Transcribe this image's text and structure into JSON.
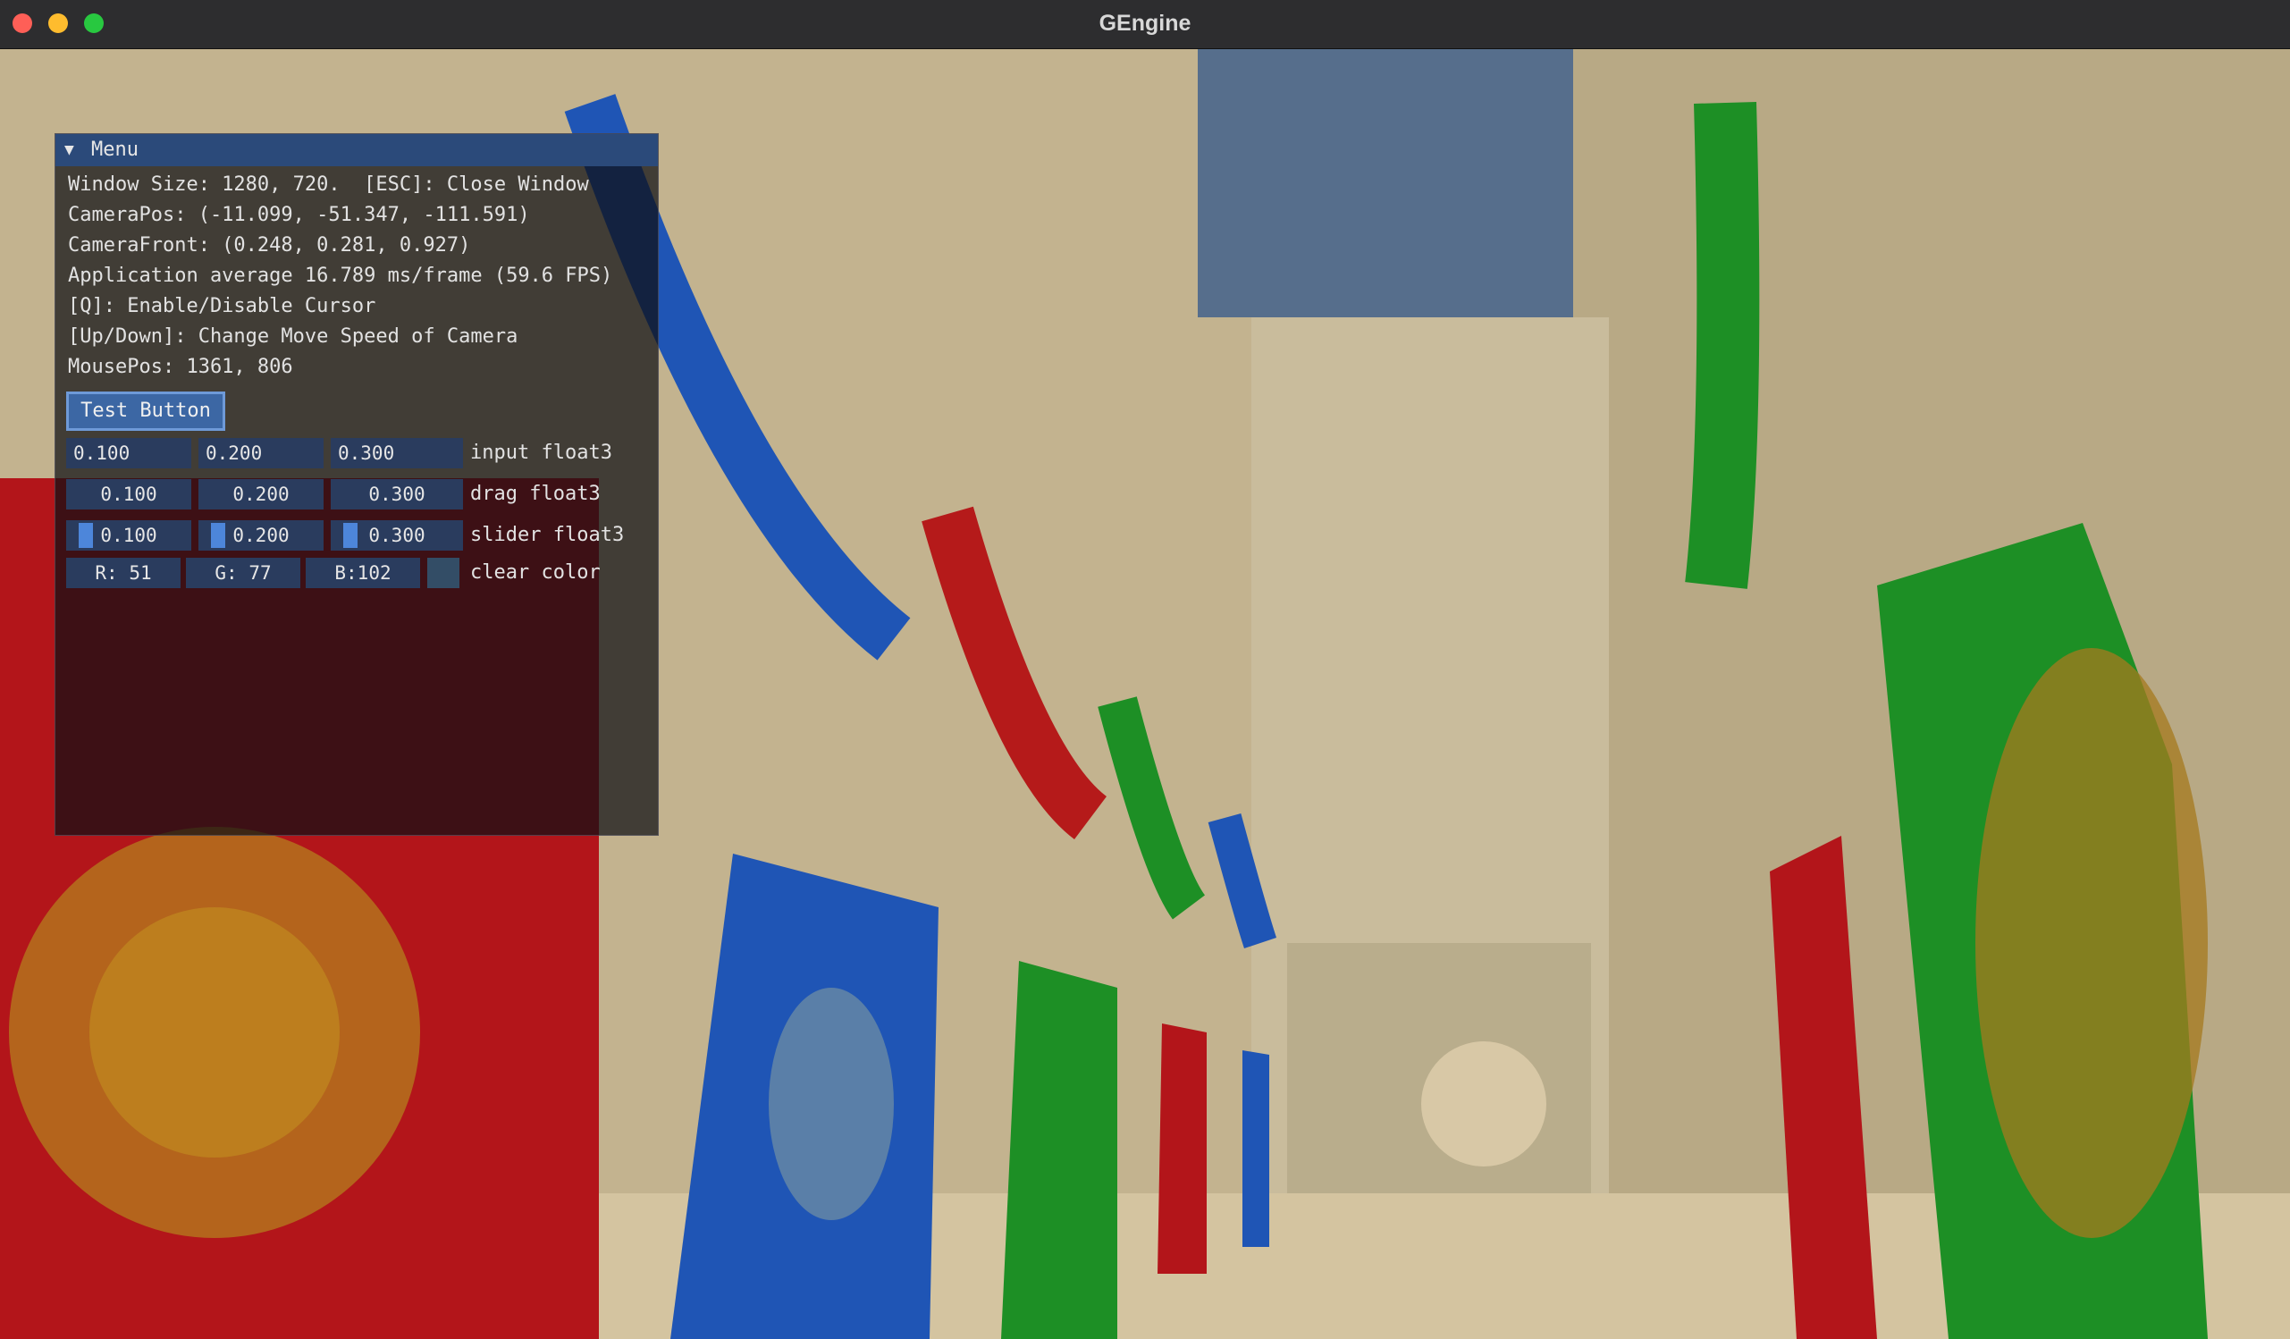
{
  "window": {
    "title": "GEngine"
  },
  "colors": {
    "clear_color": "#334d66",
    "title_bar": "#2b4a7a",
    "button": "#3c67a4",
    "slider_grab": "#4d86da"
  },
  "menu": {
    "title": "Menu",
    "collapse_icon": "triangle-down-icon",
    "lines": [
      "Window Size: 1280, 720.  [ESC]: Close Window",
      "CameraPos: (-11.099, -51.347, -111.591)",
      "CameraFront: (0.248, 0.281, 0.927)",
      "Application average 16.789 ms/frame (59.6 FPS)",
      "[Q]: Enable/Disable Cursor",
      "[Up/Down]: Change Move Speed of Camera",
      "MousePos: 1361, 806"
    ],
    "test_button": "Test Button",
    "input_float3": {
      "label": "input float3",
      "values": [
        "0.100",
        "0.200",
        "0.300"
      ]
    },
    "drag_float3": {
      "label": "drag float3",
      "values": [
        "0.100",
        "0.200",
        "0.300"
      ]
    },
    "slider_float3": {
      "label": "slider float3",
      "values": [
        "0.100",
        "0.200",
        "0.300"
      ]
    },
    "clear_color": {
      "label": "clear color",
      "values": [
        "R: 51",
        "G: 77",
        "B:102"
      ]
    }
  }
}
